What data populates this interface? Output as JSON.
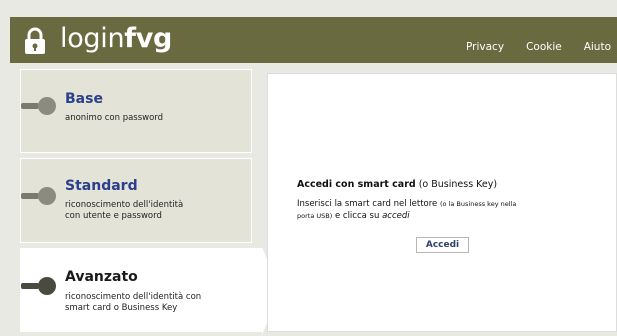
{
  "app": {
    "logo": {
      "text_light": "login",
      "text_bold": "fvg",
      "icon": "lock-icon"
    }
  },
  "nav": {
    "items": [
      "Privacy",
      "Cookie",
      "Aiuto"
    ]
  },
  "levels": [
    {
      "title": "Base",
      "desc": "anonimo con password",
      "title_color": "#2b3f8c",
      "icon": "key-lever-icon",
      "active": false
    },
    {
      "title": "Standard",
      "desc": "riconoscimento dell'identità\ncon utente e password",
      "title_color": "#2b3f8c",
      "icon": "key-lever-icon",
      "active": false
    },
    {
      "title": "Avanzato",
      "desc": "riconoscimento dell'identità con\nsmart card o Business Key",
      "title_color": "#1a1a1a",
      "icon": "key-lever-icon",
      "active": true
    }
  ],
  "panel": {
    "title_bold": "Accedi con smart card",
    "title_rest": " (o Business Key)",
    "line1_a": "Inserisci la smart card nel lettore ",
    "line1_small": "(o la Business key nella",
    "line2_small": "porta USB)",
    "line2_b": " e clicca su ",
    "line2_italic": "accedi",
    "button": "Accedi"
  },
  "colors": {
    "header": "#6a6a40",
    "background": "#e9e9e4",
    "panel": "#ffffff",
    "level_bg": "#e3e3d8"
  }
}
